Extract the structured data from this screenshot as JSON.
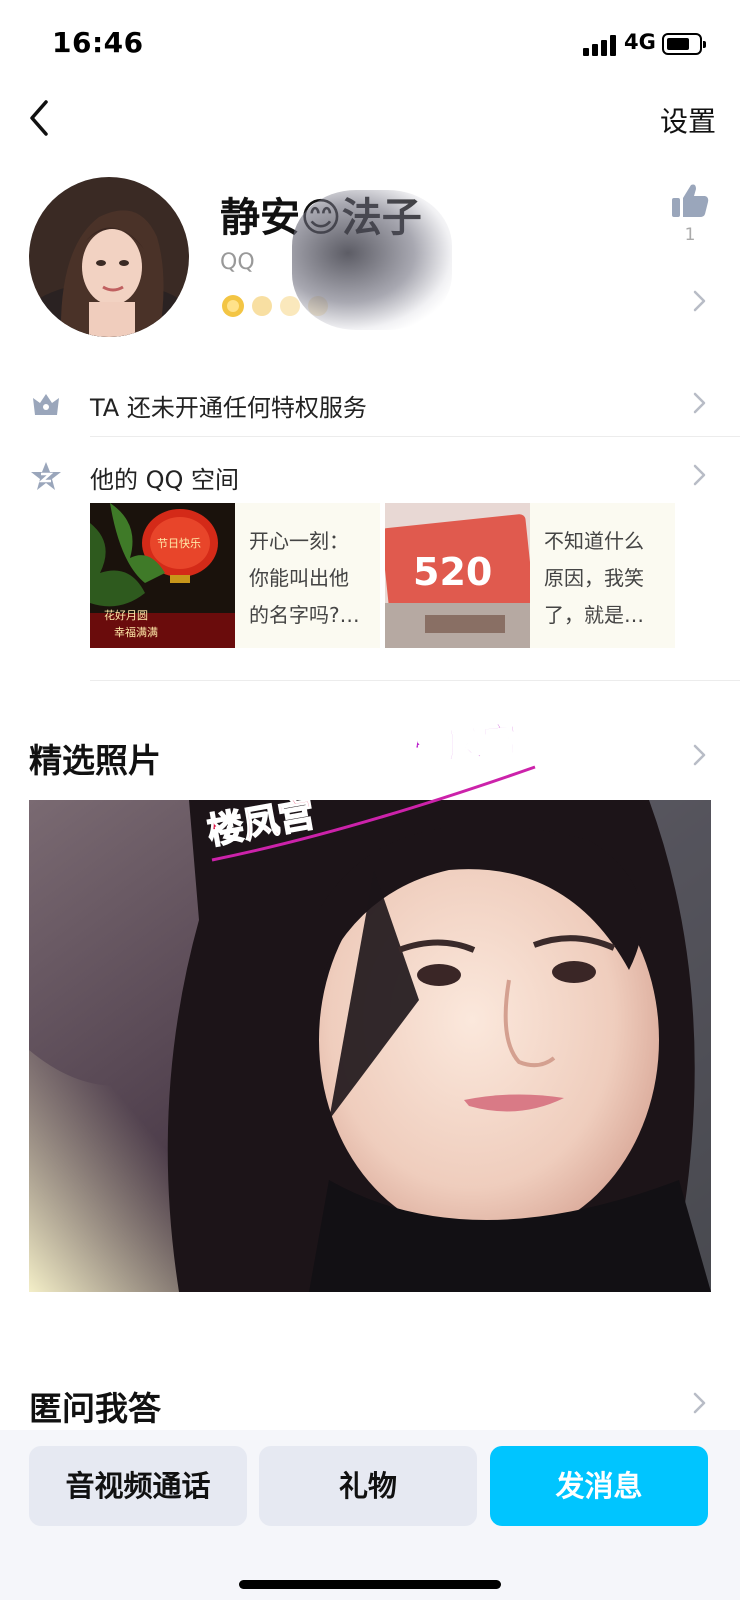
{
  "status": {
    "time": "16:46",
    "network": "4G"
  },
  "nav": {
    "settings_label": "设置"
  },
  "profile": {
    "nickname": "静安😊法子",
    "qq_prefix": "QQ",
    "like_count": "1"
  },
  "privilege": {
    "label": "TA 还未开通任何特权服务"
  },
  "qzone": {
    "label": "他的 QQ 空间",
    "posts": [
      {
        "image_caption_top": "节日快乐",
        "image_caption_bottom_1": "花好月圆",
        "image_caption_bottom_2": "幸福满满",
        "text_line1": "开心一刻：",
        "text_line2": "你能叫出他",
        "text_line3": "的名字吗?…"
      },
      {
        "image_caption": "520",
        "text_line1": "不知道什么",
        "text_line2": "原因，我笑",
        "text_line3": "了，就是…"
      }
    ]
  },
  "featured_photos": {
    "title": "精选照片",
    "watermark": "楼凤宫"
  },
  "anon_qa": {
    "title": "匿问我答"
  },
  "actions": {
    "call_label": "音视频通话",
    "gift_label": "礼物",
    "message_label": "发消息"
  },
  "colors": {
    "accent": "#00c5ff",
    "button_gray": "#e6e9f2",
    "watermark": "#cc22aa"
  },
  "icons": [
    "back-arrow-icon",
    "thumbs-up-icon",
    "crown-icon",
    "qzone-star-icon",
    "chevron-right-icon",
    "signal-icon",
    "battery-icon"
  ]
}
